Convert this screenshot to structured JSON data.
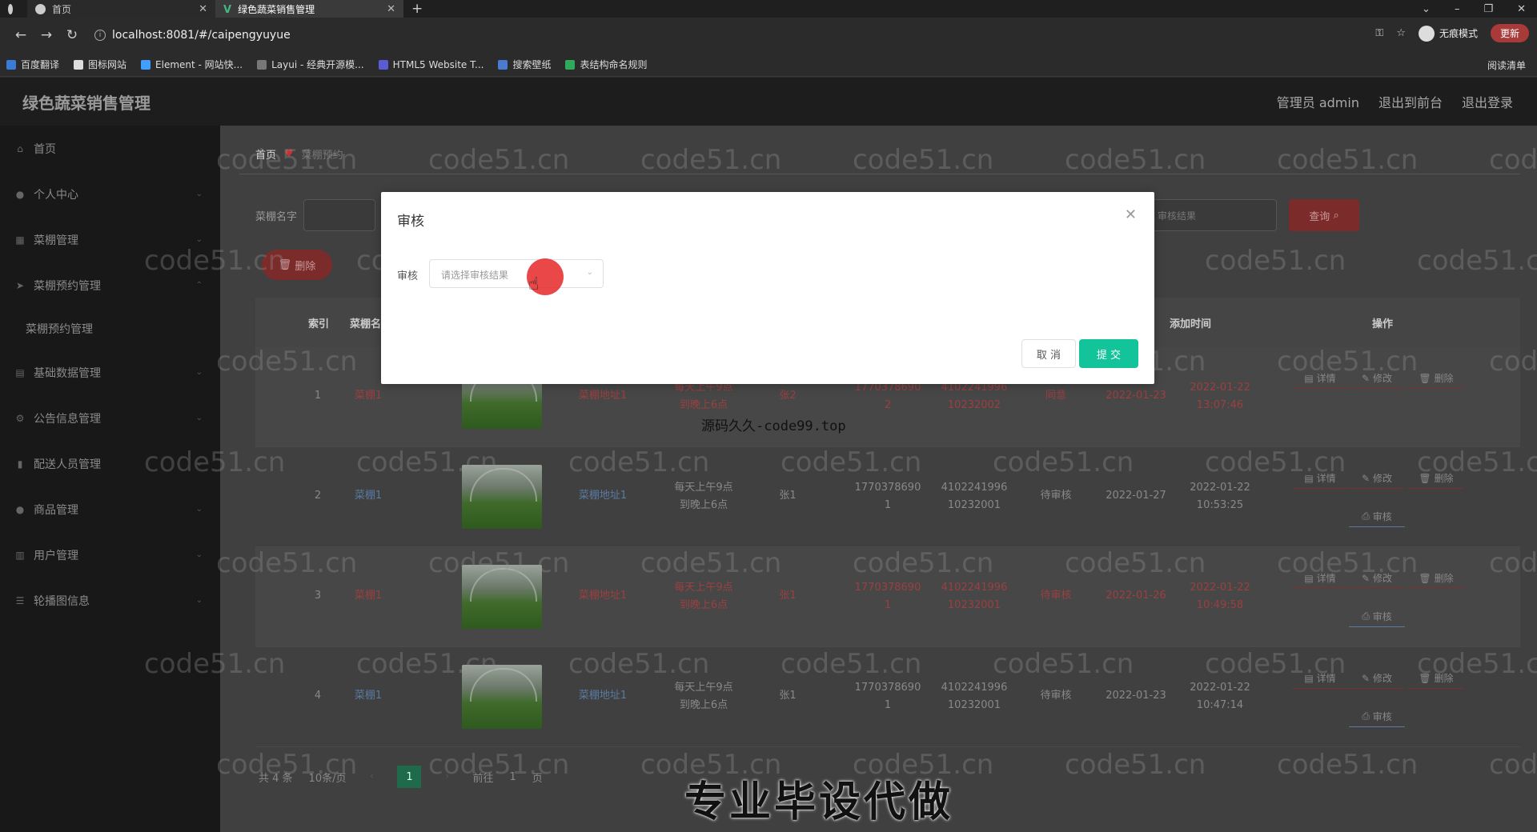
{
  "browser": {
    "tabs": [
      {
        "label": "首页"
      },
      {
        "label": "绿色蔬菜销售管理"
      }
    ],
    "url": "localhost:8081/#/caipengyuyue",
    "incognito_label": "无痕模式",
    "update_label": "更新",
    "bookmarks": [
      "百度翻译",
      "图标网站",
      "Element - 网站快...",
      "Layui - 经典开源模...",
      "HTML5 Website T...",
      "搜索壁纸",
      "表结构命名规则"
    ],
    "reading_list": "阅读清单"
  },
  "app": {
    "title": "绿色蔬菜销售管理",
    "header_links": [
      "管理员 admin",
      "退出到前台",
      "退出登录"
    ]
  },
  "sidebar": {
    "items": [
      {
        "label": "首页"
      },
      {
        "label": "个人中心"
      },
      {
        "label": "菜棚管理"
      },
      {
        "label": "菜棚预约管理"
      },
      {
        "label": "菜棚预约管理"
      },
      {
        "label": "基础数据管理"
      },
      {
        "label": "公告信息管理"
      },
      {
        "label": "配送人员管理"
      },
      {
        "label": "商品管理"
      },
      {
        "label": "用户管理"
      },
      {
        "label": "轮播图信息"
      }
    ]
  },
  "main": {
    "breadcrumb": {
      "home": "首页",
      "current": "菜棚预约"
    },
    "search": {
      "label": "菜棚名字",
      "placeholder2": "审核结果",
      "query_label": "查询"
    },
    "delete_label": "删除",
    "table": {
      "headers": [
        "索引",
        "菜棚名",
        "添加时间",
        "操作"
      ],
      "rows": [
        {
          "index": "1",
          "name": "菜棚1",
          "address": "菜棚地址1",
          "time_a": "每天上午9点",
          "time_b": "到晚上6点",
          "person": "张2",
          "phone_a": "1770378690",
          "phone_b": "2",
          "id_a": "4102241996",
          "id_b": "10232002",
          "status": "同意",
          "date": "2022-01-23",
          "added_a": "2022-01-22",
          "added_b": "13:07:46"
        },
        {
          "index": "2",
          "name": "菜棚1",
          "address": "菜棚地址1",
          "time_a": "每天上午9点",
          "time_b": "到晚上6点",
          "person": "张1",
          "phone_a": "1770378690",
          "phone_b": "1",
          "id_a": "4102241996",
          "id_b": "10232001",
          "status": "待审核",
          "date": "2022-01-27",
          "added_a": "2022-01-22",
          "added_b": "10:53:25"
        },
        {
          "index": "3",
          "name": "菜棚1",
          "address": "菜棚地址1",
          "time_a": "每天上午9点",
          "time_b": "到晚上6点",
          "person": "张1",
          "phone_a": "1770378690",
          "phone_b": "1",
          "id_a": "4102241996",
          "id_b": "10232001",
          "status": "待审核",
          "date": "2022-01-26",
          "added_a": "2022-01-22",
          "added_b": "10:49:58"
        },
        {
          "index": "4",
          "name": "菜棚1",
          "address": "菜棚地址1",
          "time_a": "每天上午9点",
          "time_b": "到晚上6点",
          "person": "张1",
          "phone_a": "1770378690",
          "phone_b": "1",
          "id_a": "4102241996",
          "id_b": "10232001",
          "status": "待审核",
          "date": "2022-01-23",
          "added_a": "2022-01-22",
          "added_b": "10:47:14"
        }
      ],
      "ops": {
        "detail": "详情",
        "edit": "修改",
        "delete": "删除",
        "review": "审核"
      }
    },
    "pager": {
      "total": "共 4 条",
      "per_page": "10条/页",
      "current": "1",
      "goto": "前往",
      "goto_val": "1",
      "page_unit": "页"
    }
  },
  "dialog": {
    "title": "审核",
    "field_label": "审核",
    "select_placeholder": "请选择审核结果",
    "cancel_label": "取 消",
    "submit_label": "提 交"
  },
  "overlays": {
    "watermark": "code51.cn",
    "source_text": "源码久久-code99.top",
    "caption": "专业毕设代做"
  }
}
